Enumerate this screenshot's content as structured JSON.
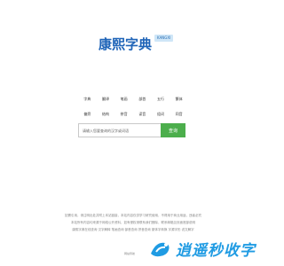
{
  "logo": {
    "title": "康熙字典",
    "badge": "KANGXI"
  },
  "categories": [
    "字典",
    "翻译",
    "笔画",
    "部首",
    "五行",
    "繁体",
    "偏旁",
    "结构",
    "拼音",
    "读音",
    "组词",
    "同音",
    "造句",
    "近义",
    "反义",
    "成语",
    "词典",
    "古文"
  ],
  "search": {
    "placeholder": "请输入您要查询的汉字或词语",
    "button_label": "查询",
    "button_color": "#4cae4c"
  },
  "footer": {
    "lines": [
      "如需引用，请注明出处并附上本站链接，本站内容仅供学习研究使用，不得用于商业用途，违者必究",
      "本站所有内容均来源于网络公开资料，如有侵权请联系我们删除，联系邮箱见页面底部说明",
      "康熙字典在线查询 汉字解释 笔画查询 部首查询 拼音查询 繁体字转换 字源字形 说文解字"
    ],
    "signature": "网站导航"
  },
  "watermark": {
    "text": "逍遥秒收字",
    "color": "#1f9be3"
  }
}
